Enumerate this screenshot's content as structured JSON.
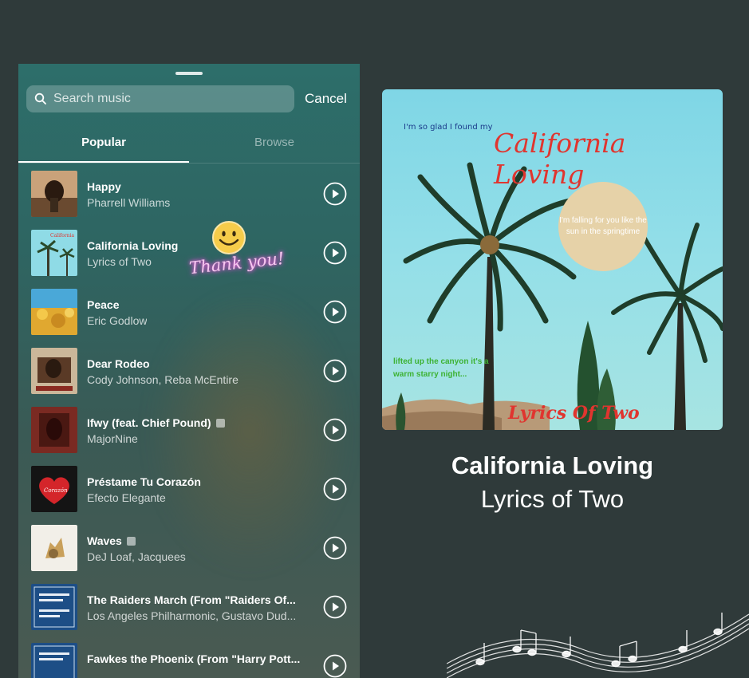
{
  "search": {
    "placeholder": "Search music",
    "cancel_label": "Cancel"
  },
  "tabs": [
    {
      "label": "Popular",
      "active": true
    },
    {
      "label": "Browse",
      "active": false
    }
  ],
  "songs": [
    {
      "title": "Happy",
      "artist": "Pharrell Williams",
      "explicit": false,
      "thumb_color": "#8a6a4a"
    },
    {
      "title": "California Loving",
      "artist": "Lyrics of Two",
      "explicit": false,
      "thumb_color": "#7fd0de"
    },
    {
      "title": "Peace",
      "artist": "Eric Godlow",
      "explicit": false,
      "thumb_color": "#e0a830"
    },
    {
      "title": "Dear Rodeo",
      "artist": "Cody Johnson, Reba McEntire",
      "explicit": false,
      "thumb_color": "#6a5540"
    },
    {
      "title": "Ifwy (feat. Chief Pound)",
      "artist": "MajorNine",
      "explicit": true,
      "thumb_color": "#7a2a22"
    },
    {
      "title": "Préstame Tu Corazón",
      "artist": "Efecto Elegante",
      "explicit": false,
      "thumb_color": "#141414"
    },
    {
      "title": "Waves",
      "artist": "DeJ Loaf, Jacquees",
      "explicit": true,
      "thumb_color": "#f2efe8"
    },
    {
      "title": "The Raiders March (From \"Raiders Of...",
      "artist": "Los Angeles Philharmonic, Gustavo Dud...",
      "explicit": false,
      "thumb_color": "#1d4e86"
    },
    {
      "title": "Fawkes the Phoenix (From \"Harry Pott...",
      "artist": "",
      "explicit": false,
      "thumb_color": "#1d4e86"
    }
  ],
  "sticker": {
    "text": "Thank you!"
  },
  "cover": {
    "top_small_text": "I'm so glad I found my",
    "title": "California Loving",
    "circle_text": "I'm falling for you like the sun in the springtime",
    "green_text": "lifted up the canyon it's a warm starry night...",
    "bottom_text": "Lyrics Of Two"
  },
  "now_playing": {
    "title": "California Loving",
    "artist": "Lyrics of Two"
  },
  "colors": {
    "background": "#2f3a3a",
    "panel": "#2e6562",
    "accent_red": "#e0352f"
  }
}
